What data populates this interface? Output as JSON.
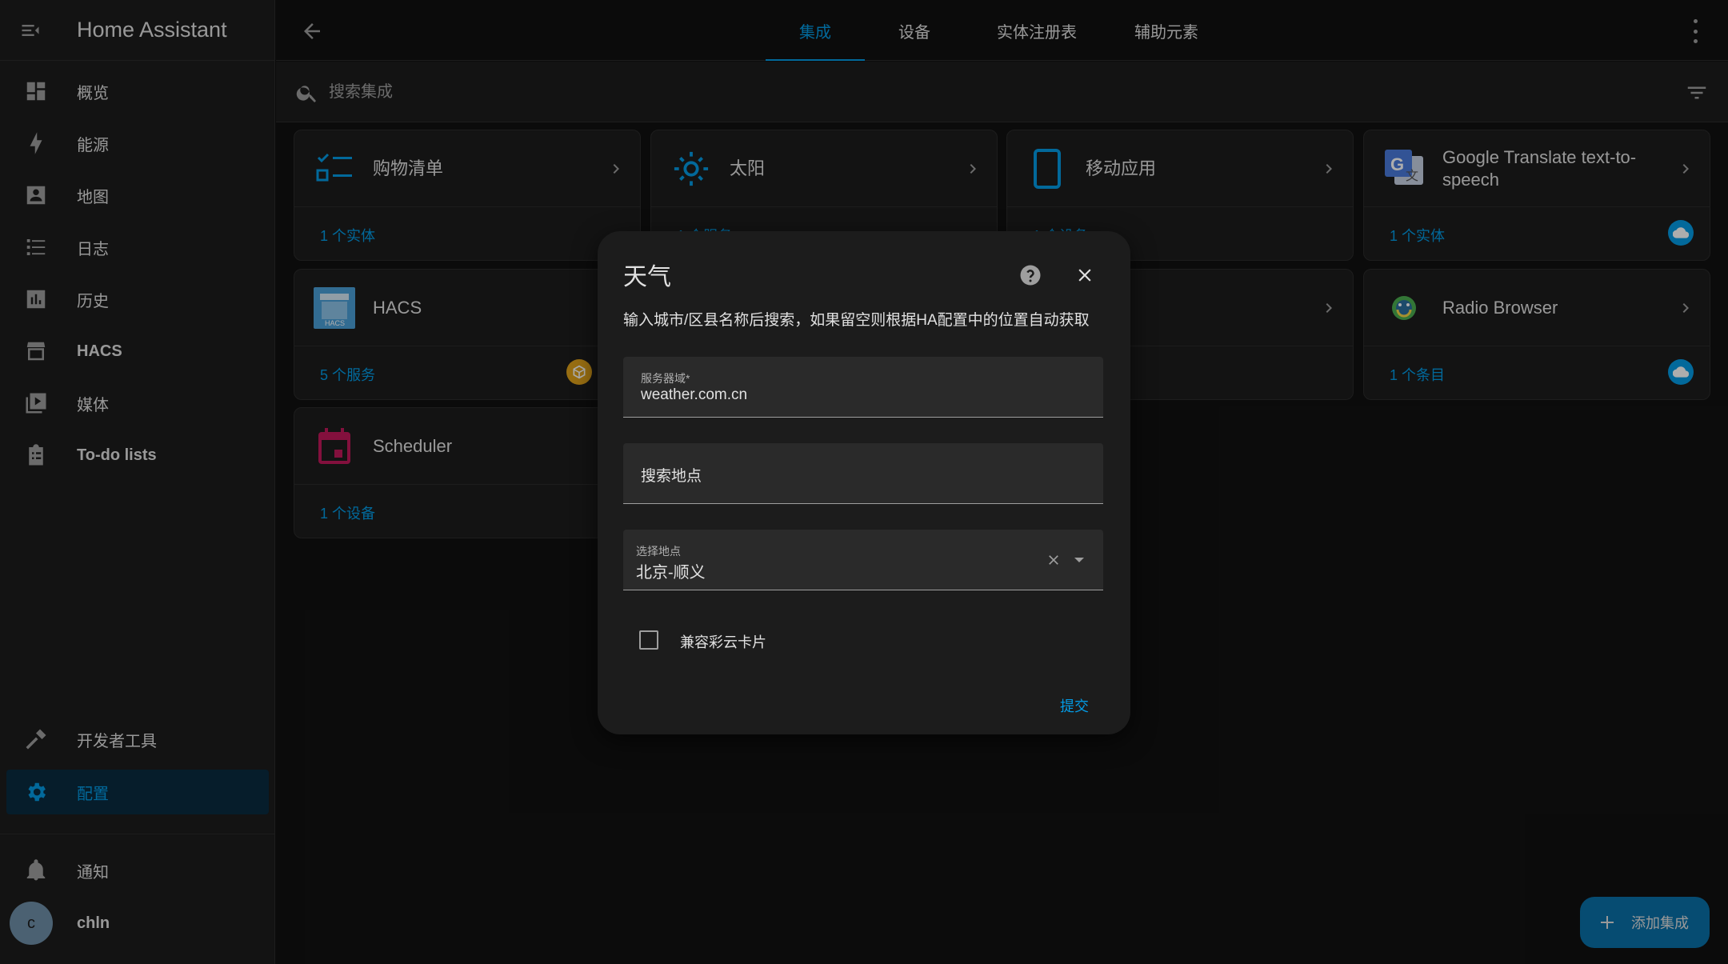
{
  "app": {
    "title": "Home Assistant"
  },
  "sidebar": {
    "items": [
      {
        "label": "概览",
        "icon": "dashboard-icon"
      },
      {
        "label": "能源",
        "icon": "lightning-bolt-icon"
      },
      {
        "label": "地图",
        "icon": "account-box-icon"
      },
      {
        "label": "日志",
        "icon": "format-list-icon"
      },
      {
        "label": "历史",
        "icon": "chart-box-icon"
      },
      {
        "label": "HACS",
        "icon": "hacs-icon"
      },
      {
        "label": "媒体",
        "icon": "play-box-multiple-icon"
      },
      {
        "label": "To-do lists",
        "icon": "clipboard-list-icon"
      }
    ],
    "developer_tools": "开发者工具",
    "settings": "配置",
    "notifications": "通知",
    "user": {
      "name": "chln",
      "initial": "c"
    }
  },
  "tabs": [
    "集成",
    "设备",
    "实体注册表",
    "辅助元素"
  ],
  "search": {
    "placeholder": "搜索集成"
  },
  "cards": [
    {
      "name": "购物清单",
      "footer": "1 个实体"
    },
    {
      "name": "太阳",
      "footer": "1 个服务"
    },
    {
      "name": "移动应用",
      "footer": "1 个设备"
    },
    {
      "name": "Google Translate text-to-speech",
      "footer": "1 个实体"
    },
    {
      "name": "HACS",
      "footer": "5 个服务"
    },
    {
      "name": "",
      "footer": ""
    },
    {
      "name": "Radio Browser",
      "footer": "1 个条目"
    },
    {
      "name": "Scheduler",
      "footer": "1 个设备"
    }
  ],
  "dialog": {
    "title": "天气",
    "description": "输入城市/区县名称后搜索，如果留空则根据HA配置中的位置自动获取",
    "server_field": {
      "label": "服务器域*",
      "value": "weather.com.cn"
    },
    "search_field": {
      "placeholder": "搜索地点"
    },
    "location_field": {
      "label": "选择地点",
      "value": "北京-顺义"
    },
    "checkbox_label": "兼容彩云卡片",
    "submit_label": "提交"
  },
  "fab": {
    "label": "添加集成"
  },
  "colors": {
    "accent": "#039be5",
    "background": "#111111",
    "card": "#1c1c1c"
  }
}
